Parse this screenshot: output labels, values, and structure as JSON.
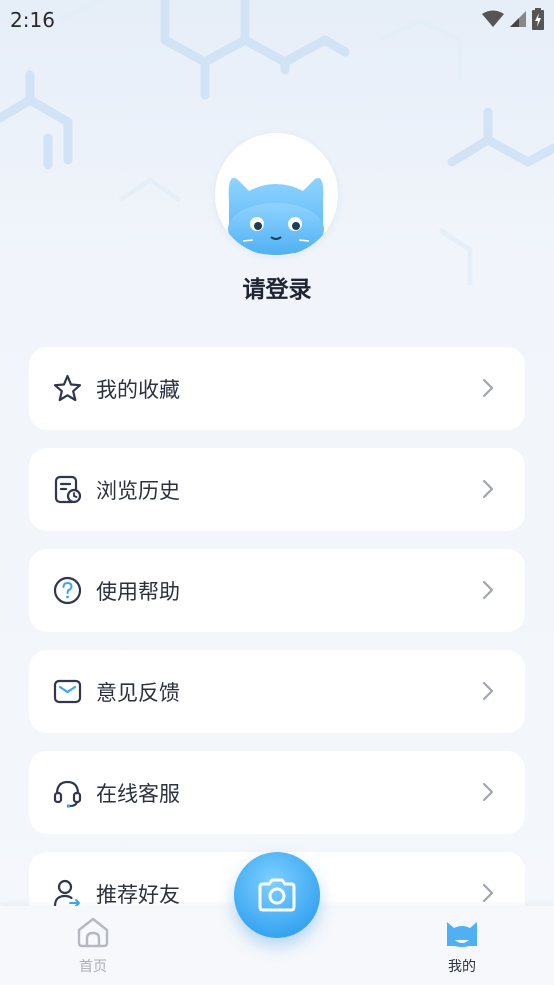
{
  "status_bar": {
    "time": "2:16"
  },
  "profile": {
    "login_label": "请登录"
  },
  "menu": {
    "items": [
      {
        "label": "我的收藏",
        "icon": "star-icon"
      },
      {
        "label": "浏览历史",
        "icon": "history-icon"
      },
      {
        "label": "使用帮助",
        "icon": "help-icon"
      },
      {
        "label": "意见反馈",
        "icon": "mail-icon"
      },
      {
        "label": "在线客服",
        "icon": "headset-icon"
      },
      {
        "label": "推荐好友",
        "icon": "share-user-icon"
      }
    ]
  },
  "tab_bar": {
    "home_label": "首页",
    "mine_label": "我的",
    "active_tab": "我的"
  },
  "colors": {
    "accent": "#3aa6f2",
    "text_primary": "#2c3140",
    "inactive": "#a9adb6"
  }
}
